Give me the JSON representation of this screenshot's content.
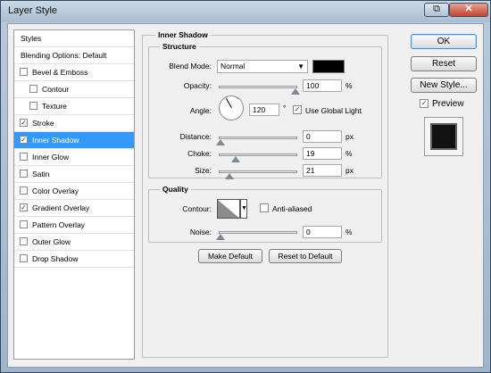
{
  "window": {
    "title": "Layer Style"
  },
  "styles_list": {
    "header": "Styles",
    "blending": "Blending Options: Default",
    "items": [
      {
        "label": "Bevel & Emboss",
        "checked": false,
        "indent": false
      },
      {
        "label": "Contour",
        "checked": false,
        "indent": true
      },
      {
        "label": "Texture",
        "checked": false,
        "indent": true
      },
      {
        "label": "Stroke",
        "checked": true,
        "indent": false
      },
      {
        "label": "Inner Shadow",
        "checked": true,
        "indent": false,
        "selected": true
      },
      {
        "label": "Inner Glow",
        "checked": false,
        "indent": false
      },
      {
        "label": "Satin",
        "checked": false,
        "indent": false
      },
      {
        "label": "Color Overlay",
        "checked": false,
        "indent": false
      },
      {
        "label": "Gradient Overlay",
        "checked": true,
        "indent": false
      },
      {
        "label": "Pattern Overlay",
        "checked": false,
        "indent": false
      },
      {
        "label": "Outer Glow",
        "checked": false,
        "indent": false
      },
      {
        "label": "Drop Shadow",
        "checked": false,
        "indent": false
      }
    ]
  },
  "panel": {
    "title": "Inner Shadow",
    "structure": {
      "title": "Structure",
      "blend_mode_label": "Blend Mode:",
      "blend_mode_value": "Normal",
      "opacity_label": "Opacity:",
      "opacity_value": "100",
      "angle_label": "Angle:",
      "angle_value": "120",
      "angle_unit": "°",
      "use_global_light": "Use Global Light",
      "distance_label": "Distance:",
      "distance_value": "0",
      "choke_label": "Choke:",
      "choke_value": "19",
      "size_label": "Size:",
      "size_value": "21"
    },
    "quality": {
      "title": "Quality",
      "contour_label": "Contour:",
      "anti_aliased": "Anti-aliased",
      "noise_label": "Noise:",
      "noise_value": "0"
    },
    "units": {
      "percent": "%",
      "px": "px"
    },
    "make_default": "Make Default",
    "reset_default": "Reset to Default"
  },
  "buttons": {
    "ok": "OK",
    "reset": "Reset",
    "new_style": "New Style...",
    "preview": "Preview"
  }
}
